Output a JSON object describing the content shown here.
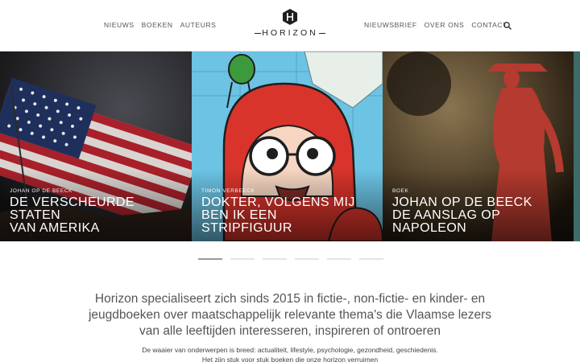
{
  "nav": {
    "left": [
      "NIEUWS",
      "BOEKEN",
      "AUTEURS"
    ],
    "right": [
      "NIEUWSBRIEF",
      "OVER ONS",
      "CONTACT"
    ]
  },
  "logo": {
    "text": "HORIZON",
    "icon": "h-hexagon-logo-icon"
  },
  "search": {
    "icon": "search-icon"
  },
  "slides": [
    {
      "kicker": "Johan Op de Beeck",
      "title_lines": [
        "DE VERSCHEURDE",
        "STATEN",
        "VAN AMERIKA"
      ]
    },
    {
      "kicker": "Timon Verbeeck",
      "title_lines": [
        "DOKTER, VOLGENS MIJ",
        "BEN IK EEN",
        "STRIPFIGUUR"
      ]
    },
    {
      "kicker": "Boek",
      "title_lines": [
        "JOHAN OP DE BEECK",
        "DE AANSLAG OP",
        "NAPOLEON"
      ]
    }
  ],
  "slider": {
    "dot_count": 6,
    "active_index": 0
  },
  "intro": {
    "lines": [
      "Horizon specialiseert zich sinds 2015 in fictie-, non-fictie- en kinder- en",
      "jeugdboeken over maatschappelijk relevante thema's die Vlaamse lezers",
      "van alle leeftijden interesseren, inspireren of ontroeren"
    ],
    "sub_lines": [
      "De waaier van onderwerpen is breed: actualiteit, lifestyle, psychologie, gezondheid, geschiedenis.",
      "Het zijn stuk voor stuk boeken die onze horizon verruimen"
    ]
  },
  "colors": {
    "accent_red": "#d9342b",
    "nav_text": "#555555",
    "slider_teal": "#3c6b6a"
  }
}
